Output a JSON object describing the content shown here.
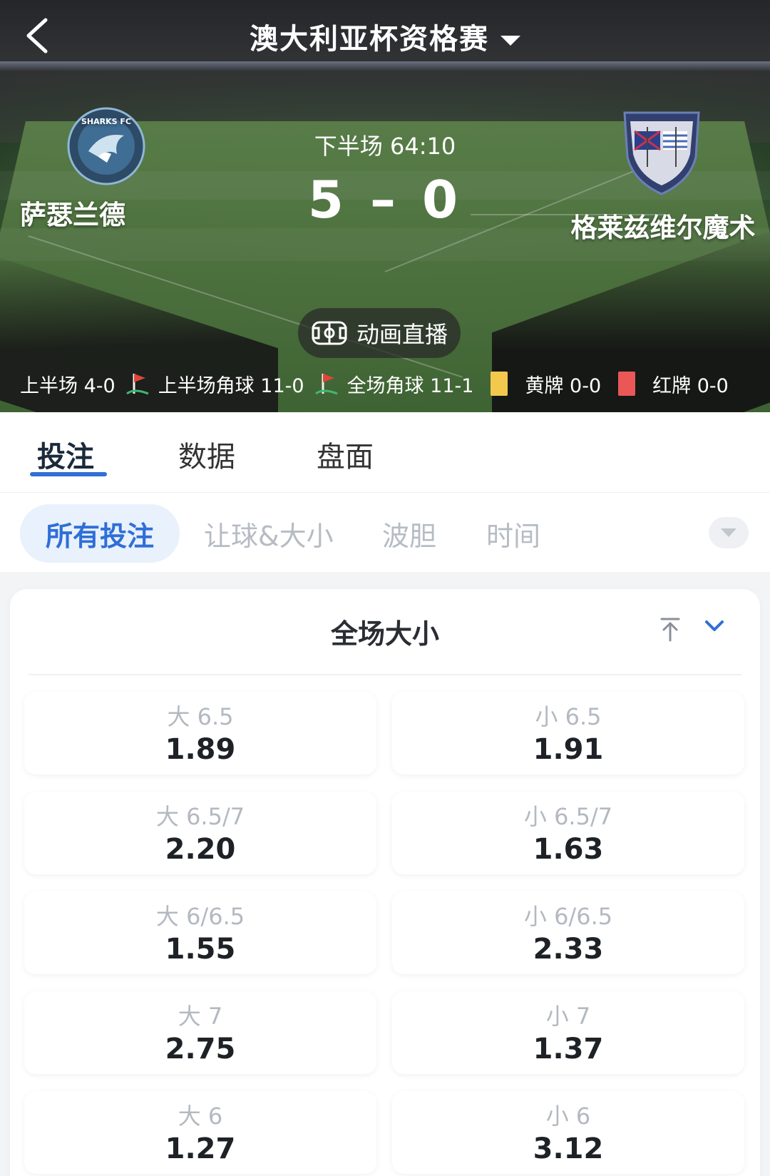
{
  "header": {
    "league": "澳大利亚杯资格赛"
  },
  "match": {
    "home_team": "萨瑟兰德",
    "away_team": "格莱兹维尔魔术",
    "home_logo_text": "SHARKS FC",
    "period_time": "下半场 64:10",
    "score": "5 – 0",
    "animation_label": "动画直播"
  },
  "stats": {
    "first_half": "上半场 4-0",
    "first_half_corners": "上半场角球 11-0",
    "full_corners": "全场角球 11-1",
    "yellow_cards": "黄牌 0-0",
    "red_cards": "红牌 0-0"
  },
  "tabs": [
    {
      "label": "投注"
    },
    {
      "label": "数据"
    },
    {
      "label": "盘面"
    }
  ],
  "filters": [
    {
      "label": "所有投注"
    },
    {
      "label": "让球&大小"
    },
    {
      "label": "波胆"
    },
    {
      "label": "时间"
    }
  ],
  "market": {
    "title": "全场大小",
    "rows": [
      {
        "over_label": "大 6.5",
        "over_odds": "1.89",
        "under_label": "小 6.5",
        "under_odds": "1.91"
      },
      {
        "over_label": "大 6.5/7",
        "over_odds": "2.20",
        "under_label": "小 6.5/7",
        "under_odds": "1.63"
      },
      {
        "over_label": "大 6/6.5",
        "over_odds": "1.55",
        "under_label": "小 6/6.5",
        "under_odds": "2.33"
      },
      {
        "over_label": "大 7",
        "over_odds": "2.75",
        "under_label": "小 7",
        "under_odds": "1.37"
      },
      {
        "over_label": "大 6",
        "over_odds": "1.27",
        "under_label": "小 6",
        "under_odds": "3.12"
      }
    ]
  },
  "colors": {
    "accent": "#2f6fd6",
    "chip_active_bg": "#e8f1fc",
    "yellow_card": "#f2c94c",
    "red_card": "#eb5757",
    "corner_flag": "#e0453a"
  },
  "icons": {
    "back": "chevron-left-icon",
    "league_dropdown": "caret-down-icon",
    "animation": "pitch-icon",
    "corner": "corner-flag-icon",
    "pin": "pin-top-icon",
    "collapse": "chevron-down-icon",
    "filter_toggle": "triangle-down-icon"
  }
}
